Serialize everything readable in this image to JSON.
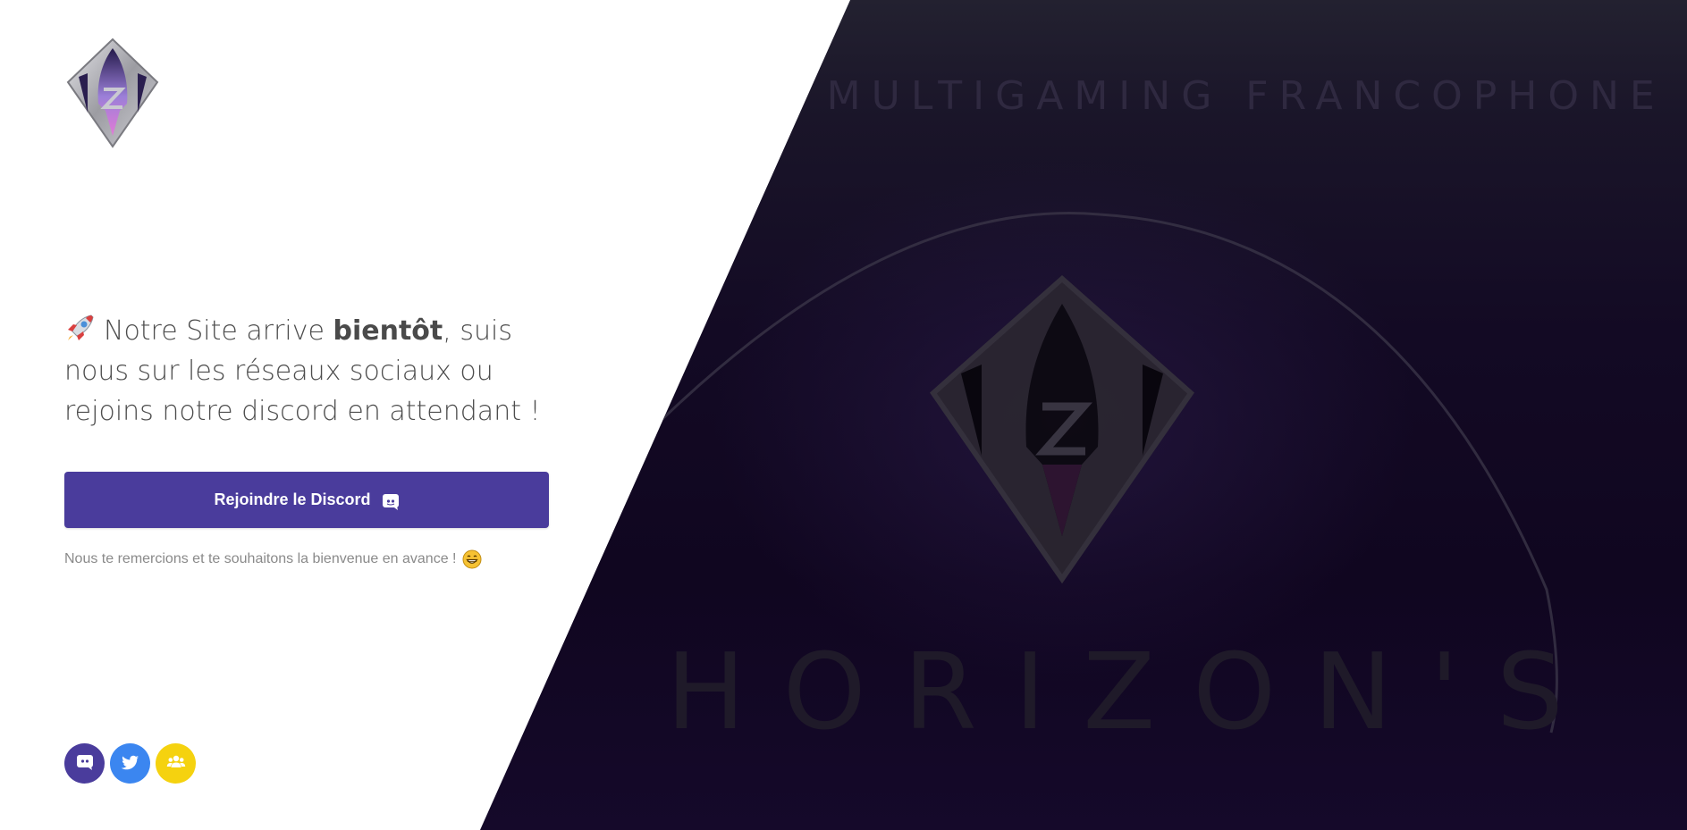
{
  "hero": {
    "tagline": "TÉ MULTIGAMING FRANCOPHONE",
    "brand": "HORIZON'S"
  },
  "logo": {
    "icon": "horizons-logo-icon",
    "letter": "Z"
  },
  "intro": {
    "emoji": "rocket-icon",
    "text_before": "Notre Site arrive ",
    "text_bold": "bientôt",
    "text_after": ", suis nous sur les réseaux sociaux ou rejoins notre discord en attendant !"
  },
  "cta": {
    "label": "Rejoindre le Discord",
    "icon": "discord-icon",
    "color": "#4a3c9c"
  },
  "thanks": {
    "text": "Nous te remercions et te souhaitons la bienvenue en avance !",
    "emoji": "grinning-face-icon"
  },
  "socials": [
    {
      "name": "discord",
      "icon": "discord-icon",
      "color": "#4a3c9c"
    },
    {
      "name": "twitter",
      "icon": "twitter-icon",
      "color": "#3b86f0"
    },
    {
      "name": "community",
      "icon": "users-icon",
      "color": "#f5d20f"
    }
  ]
}
